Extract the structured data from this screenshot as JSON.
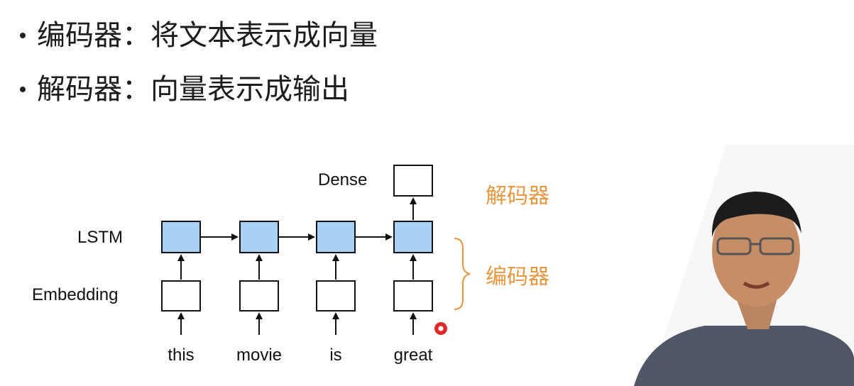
{
  "bullets": [
    {
      "text": "编码器：将文本表示成向量"
    },
    {
      "text": "解码器：向量表示成输出"
    }
  ],
  "diagram": {
    "row_labels": {
      "dense": "Dense",
      "lstm": "LSTM",
      "embedding": "Embedding"
    },
    "tokens": [
      "this",
      "movie",
      "is",
      "great"
    ],
    "brace_labels": {
      "decoder": "解码器",
      "encoder": "编码器"
    },
    "colors": {
      "lstm_fill": "#a9d0f5",
      "box_stroke": "#111111",
      "brace": "#e8963f",
      "accent_text": "#e8963f"
    }
  },
  "presenter": {
    "icon": "presenter-video-icon"
  }
}
